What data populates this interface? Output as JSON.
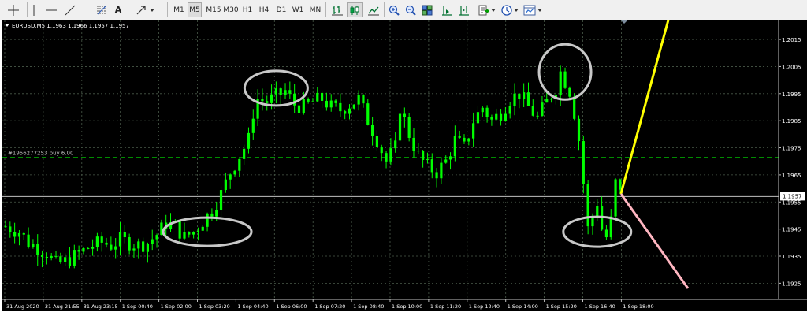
{
  "toolbar": {
    "timeframes": [
      "M1",
      "M5",
      "M15",
      "M30",
      "H1",
      "H4",
      "D1",
      "W1",
      "MN"
    ],
    "active_timeframe": "M5",
    "text_tool": "A",
    "icons": [
      "crosshair-icon",
      "vertical-line-icon",
      "horizontal-line-icon",
      "trendline-icon",
      "fibonacci-icon",
      "text-icon",
      "arrows-icon",
      "bar-chart-icon",
      "candlestick-icon",
      "line-chart-icon",
      "zoom-in-icon",
      "zoom-out-icon",
      "tile-windows-icon",
      "auto-scroll-icon",
      "chart-shift-icon",
      "indicators-icon",
      "periods-icon",
      "templates-icon"
    ]
  },
  "chart": {
    "symbol_info": "EURUSD,M5  1.1963 1.1966 1.1957 1.1957",
    "order_label": "#1956277253 buy 6.00",
    "current_price_label": "1.1957",
    "y_ticks": [
      "1.2015",
      "1.2005",
      "1.1995",
      "1.1985",
      "1.1975",
      "1.1965",
      "1.1955",
      "1.1945",
      "1.1935",
      "1.1925"
    ],
    "x_ticks": [
      "31 Aug 2020",
      "31 Aug 21:55",
      "31 Aug 23:15",
      "1 Sep 00:40",
      "1 Sep 02:00",
      "1 Sep 03:20",
      "1 Sep 04:40",
      "1 Sep 06:00",
      "1 Sep 07:20",
      "1 Sep 08:40",
      "1 Sep 10:00",
      "1 Sep 11:20",
      "1 Sep 12:40",
      "1 Sep 14:00",
      "1 Sep 15:20",
      "1 Sep 16:40",
      "1 Sep 18:00"
    ],
    "colors": {
      "background": "#000000",
      "candle": "#00ff00",
      "grid": "#4a5a4a",
      "order_line": "#00a000",
      "bid_line": "#c0c0c0",
      "circle": "#c8c8c8",
      "yellow_line": "#ffff00",
      "pink_line": "#ffb6c1"
    }
  },
  "chart_data": {
    "type": "candlestick",
    "title": "EURUSD,M5",
    "ohlc_readout": {
      "open": 1.1963,
      "high": 1.1966,
      "low": 1.1957,
      "close": 1.1957
    },
    "ylim": [
      1.1919,
      1.2022
    ],
    "order_level": 1.19715,
    "current_price": 1.1957,
    "price_path": [
      [
        0,
        1.1946
      ],
      [
        3,
        1.1944
      ],
      [
        5,
        1.194
      ],
      [
        7,
        1.1938
      ],
      [
        9,
        1.1936
      ],
      [
        11,
        1.1932
      ],
      [
        13,
        1.1933
      ],
      [
        15,
        1.1935
      ],
      [
        17,
        1.1937
      ],
      [
        19,
        1.1939
      ],
      [
        21,
        1.194
      ],
      [
        23,
        1.1939
      ],
      [
        25,
        1.1941
      ],
      [
        27,
        1.194
      ],
      [
        29,
        1.1939
      ],
      [
        31,
        1.194
      ],
      [
        33,
        1.1943
      ],
      [
        35,
        1.1947
      ],
      [
        37,
        1.1946
      ],
      [
        39,
        1.1942
      ],
      [
        41,
        1.1944
      ],
      [
        43,
        1.1948
      ],
      [
        45,
        1.1952
      ],
      [
        47,
        1.1958
      ],
      [
        49,
        1.1966
      ],
      [
        51,
        1.1972
      ],
      [
        53,
        1.1978
      ],
      [
        54,
        1.1988
      ],
      [
        55,
        1.1993
      ],
      [
        57,
        1.1992
      ],
      [
        59,
        1.1994
      ],
      [
        61,
        1.1996
      ],
      [
        63,
        1.1991
      ],
      [
        65,
        1.199
      ],
      [
        67,
        1.1992
      ],
      [
        69,
        1.1993
      ],
      [
        71,
        1.199
      ],
      [
        73,
        1.1989
      ],
      [
        75,
        1.1991
      ],
      [
        77,
        1.1993
      ],
      [
        79,
        1.1985
      ],
      [
        81,
        1.1978
      ],
      [
        83,
        1.197
      ],
      [
        85,
        1.1975
      ],
      [
        86,
        1.199
      ],
      [
        88,
        1.198
      ],
      [
        90,
        1.1972
      ],
      [
        92,
        1.1968
      ],
      [
        94,
        1.1966
      ],
      [
        96,
        1.197
      ],
      [
        98,
        1.1978
      ],
      [
        100,
        1.1975
      ],
      [
        102,
        1.1985
      ],
      [
        104,
        1.199
      ],
      [
        106,
        1.1985
      ],
      [
        108,
        1.1988
      ],
      [
        110,
        1.1993
      ],
      [
        112,
        1.1995
      ],
      [
        114,
        1.199
      ],
      [
        116,
        1.1986
      ],
      [
        118,
        1.1992
      ],
      [
        120,
        1.1997
      ],
      [
        121,
        1.2003
      ],
      [
        123,
        1.1996
      ],
      [
        124,
        1.1988
      ],
      [
        125,
        1.1978
      ],
      [
        126,
        1.1962
      ],
      [
        127,
        1.1945
      ],
      [
        128,
        1.195
      ],
      [
        129,
        1.1955
      ],
      [
        130,
        1.1945
      ],
      [
        131,
        1.1942
      ],
      [
        132,
        1.1948
      ],
      [
        133,
        1.1962
      ],
      [
        134,
        1.1958
      ]
    ],
    "annotations": {
      "circles": [
        {
          "bar": 44,
          "price": 1.1944
        },
        {
          "bar": 59,
          "price": 1.1997
        },
        {
          "bar": 122,
          "price": 1.2003
        },
        {
          "bar": 129,
          "price": 1.1944
        }
      ],
      "lines": [
        {
          "color": "yellow",
          "from": {
            "bar": 134,
            "price": 1.1958
          },
          "to_direction": "up-right, beyond chart top"
        },
        {
          "color": "pink",
          "from": {
            "bar": 134,
            "price": 1.1958
          },
          "to_direction": "down-right, beyond chart bottom"
        }
      ]
    }
  }
}
